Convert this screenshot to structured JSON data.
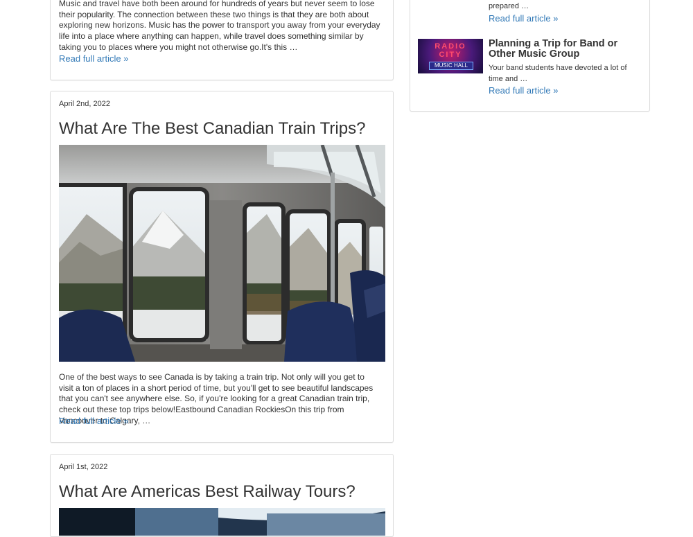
{
  "posts": [
    {
      "excerpt": "Music and travel have both been around for hundreds of years but never seem to lose their popularity. The connection between these two things is that they are both about exploring new horizons. Music has the power to transport you away from your everyday life into a place where anything can happen, while travel does something similar by taking you to places where you might not otherwise go.It's this …",
      "read_more": "Read full article »"
    },
    {
      "date": "April 2nd, 2022",
      "title": "What Are The Best Canadian Train Trips?",
      "image_alt": "train-car-mountain-view",
      "excerpt": "One of the best ways to see Canada is by taking a train trip. Not only will you get to visit a ton of places in a short period of time, but you'll get to see beautiful landscapes that you can't see anywhere else. So, if you're looking for a great Canadian train trip, check out these top trips below!Eastbound Canadian RockiesOn this trip from Vancouver to Calgary, …",
      "read_more": "Read full article »"
    },
    {
      "date": "April 1st, 2022",
      "title": "What Are Americas Best Railway Tours?"
    }
  ],
  "sidebar": {
    "items": [
      {
        "excerpt": "prepared …",
        "read_more": "Read full article »"
      },
      {
        "title": "Planning a Trip for Band or Other Music Group",
        "excerpt": "Your band students have devoted a lot of time and …",
        "read_more": "Read full article »",
        "thumb_text_1": "RADIO",
        "thumb_text_2": "CITY",
        "thumb_text_3": "MUSIC HALL"
      }
    ]
  },
  "colors": {
    "link": "#337ab7",
    "border": "#dcdcdc",
    "text": "#333333"
  }
}
